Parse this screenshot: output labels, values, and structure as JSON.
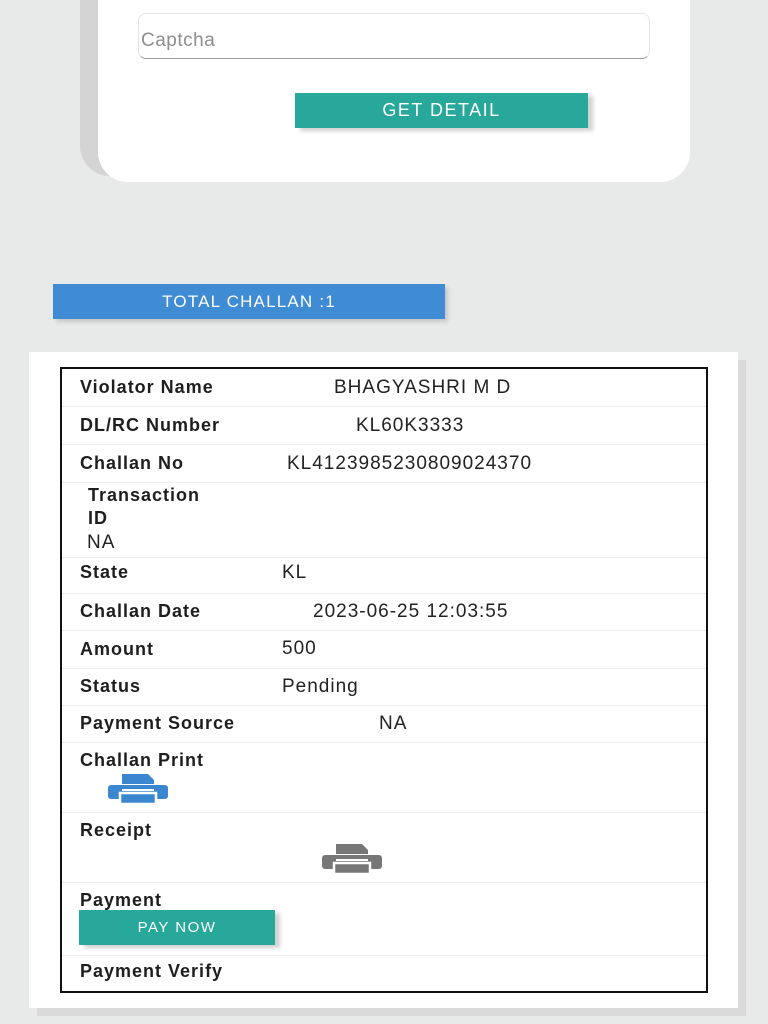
{
  "form": {
    "captcha_placeholder": "Captcha",
    "get_detail_label": "GET DETAIL"
  },
  "summary": {
    "total_challan_label": "TOTAL CHALLAN :1"
  },
  "challan": {
    "violator_name_label": "Violator Name",
    "violator_name": "BHAGYASHRI M D",
    "dl_rc_label": "DL/RC Number",
    "dl_rc": "KL60K3333",
    "challan_no_label": "Challan No",
    "challan_no": "KL4123985230809024370",
    "transaction_label_1": "Transaction",
    "transaction_label_2": "ID",
    "transaction_id": "NA",
    "state_label": "State",
    "state": "KL",
    "challan_date_label": "Challan Date",
    "challan_date": "2023-06-25 12:03:55",
    "amount_label": "Amount",
    "amount": "500",
    "status_label": "Status",
    "status": "Pending",
    "payment_source_label": "Payment Source",
    "payment_source": "NA",
    "challan_print_label": "Challan Print",
    "receipt_label": "Receipt",
    "payment_label": "Payment",
    "pay_now_label": "PAY NOW",
    "payment_verify_label": "Payment Verify"
  },
  "icons": {
    "challan_print": "printer-icon",
    "receipt": "printer-icon"
  },
  "colors": {
    "teal": "#27a89a",
    "blue": "#3f8bd4",
    "print_icon": "#3a87d0",
    "receipt_icon": "#777777"
  }
}
